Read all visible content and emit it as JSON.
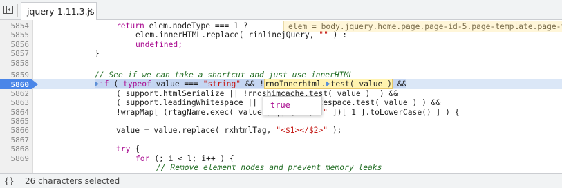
{
  "tab": {
    "filename": "jquery-1.11.3.js",
    "close": "×"
  },
  "gutter": {
    "lines": [
      "5854",
      "5855",
      "5856",
      "5857",
      "5858",
      "5859",
      "5860",
      "5861",
      "5862",
      "5863",
      "5864",
      "5865",
      "5866",
      "5867",
      "5868",
      "5869"
    ],
    "active_line": "5860"
  },
  "code": {
    "l5854_kw": "return",
    "l5854_rest": " elem.nodeType === 1 ?",
    "l5855": "elem.innerHTML.replace( rinlinejQuery, ",
    "l5855_str": "\"\"",
    "l5855_end": " ) :",
    "l5856": "undefined;",
    "l5857": "}",
    "l5859_comment": "// See if we can take a shortcut and just use innerHTML",
    "l5860_if": "if",
    "l5860_a": " ( ",
    "l5860_typeof": "typeof",
    "l5860_b": " value === ",
    "l5860_str": "\"string\"",
    "l5860_c": " && !",
    "l5860_rno": "rnoInnerhtml.",
    "l5860_test": "test( value )",
    "l5860_end": " &&",
    "l5861": "( support.htmlSerialize || !rnoshimcache.test( value )  ) &&",
    "l5862": "( support.leadingWhitespace || !rleadingWhitespace.test( value ) ) &&",
    "l5863_a": "!wrapMap[ (rtagName.exec( value ) || [ ",
    "l5863_str": "\"\"",
    "l5863_b": ", ",
    "l5863_str2": "\"\"",
    "l5863_c": " ])[ 1 ].toLowerCase() ] ) {",
    "l5865_a": "value = value.replace( rxhtmlTag, ",
    "l5865_str": "\"<$1></$2>\"",
    "l5865_b": " );",
    "l5867_kw": "try",
    "l5867_b": " {",
    "l5868_kw": "for",
    "l5868_b": " (; i < l; i++ ) {",
    "l5869_comment": "// Remove element nodes and prevent memory leaks"
  },
  "inline_value": "elem = body.jquery.home.page.page-id-5.page-template.page-te",
  "popover": {
    "value": "true"
  },
  "status": {
    "text": "26 characters selected",
    "icon": "{}"
  }
}
